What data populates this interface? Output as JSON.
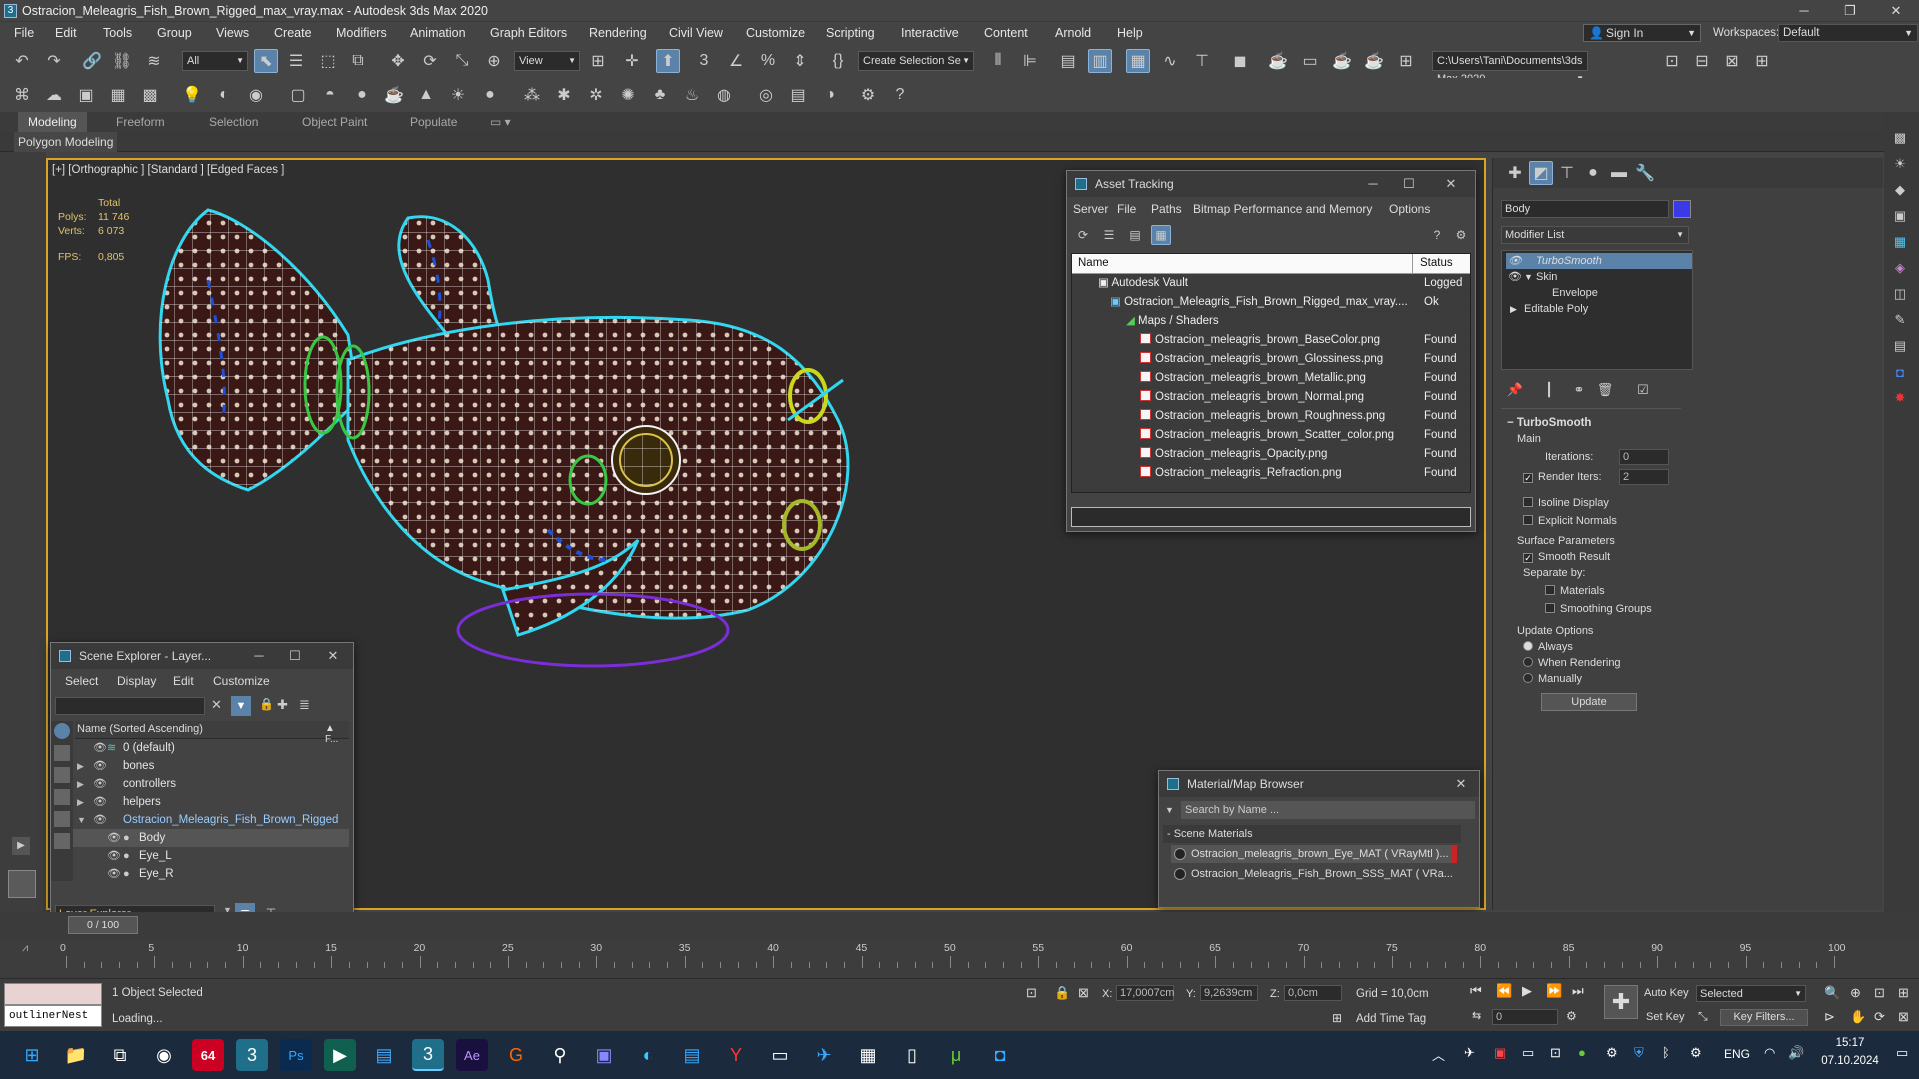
{
  "window": {
    "title": "Ostracion_Meleagris_Fish_Brown_Rigged_max_vray.max - Autodesk 3ds Max 2020",
    "app_icon": "3"
  },
  "menu": [
    "File",
    "Edit",
    "Tools",
    "Group",
    "Views",
    "Create",
    "Modifiers",
    "Animation",
    "Graph Editors",
    "Rendering",
    "Civil View",
    "Customize",
    "Scripting",
    "Interactive",
    "Content",
    "Arnold",
    "Help"
  ],
  "account": {
    "sign_in": "Sign In",
    "workspaces_label": "Workspaces:",
    "workspace": "Default"
  },
  "toolbar": {
    "selection_filter": "All",
    "ref_coord": "View",
    "named_selection": "Create Selection Se",
    "project_path": "C:\\Users\\Tani\\Documents\\3ds Max 2020"
  },
  "ribbon": {
    "tabs": [
      "Modeling",
      "Freeform",
      "Selection",
      "Object Paint",
      "Populate"
    ],
    "active_tab": "Modeling",
    "subpanel": "Polygon Modeling"
  },
  "viewport": {
    "label": "[+] [Orthographic ] [Standard ] [Edged Faces ]",
    "stats": {
      "total_label": "Total",
      "polys_label": "Polys:",
      "polys": "11 746",
      "verts_label": "Verts:",
      "verts": "6 073",
      "fps_label": "FPS:",
      "fps": "0,805"
    }
  },
  "asset_tracking": {
    "title": "Asset Tracking",
    "menu": [
      "Server",
      "File",
      "Paths",
      "Bitmap Performance and Memory",
      "Options"
    ],
    "columns": [
      "Name",
      "Status"
    ],
    "rows": [
      {
        "name": "Autodesk Vault",
        "status": "Logged"
      },
      {
        "name": "Ostracion_Meleagris_Fish_Brown_Rigged_max_vray....",
        "status": "Ok"
      },
      {
        "name": "Maps / Shaders",
        "status": ""
      },
      {
        "name": "Ostracion_meleagris_brown_BaseColor.png",
        "status": "Found"
      },
      {
        "name": "Ostracion_meleagris_brown_Glossiness.png",
        "status": "Found"
      },
      {
        "name": "Ostracion_meleagris_brown_Metallic.png",
        "status": "Found"
      },
      {
        "name": "Ostracion_meleagris_brown_Normal.png",
        "status": "Found"
      },
      {
        "name": "Ostracion_meleagris_brown_Roughness.png",
        "status": "Found"
      },
      {
        "name": "Ostracion_meleagris_brown_Scatter_color.png",
        "status": "Found"
      },
      {
        "name": "Ostracion_meleagris_Opacity.png",
        "status": "Found"
      },
      {
        "name": "Ostracion_meleagris_Refraction.png",
        "status": "Found"
      }
    ]
  },
  "scene_explorer": {
    "title": "Scene Explorer - Layer...",
    "menu": [
      "Select",
      "Display",
      "Edit",
      "Customize"
    ],
    "column": "Name (Sorted Ascending)",
    "column_right": "▲ F...",
    "rows": [
      {
        "name": "0 (default)"
      },
      {
        "name": "bones"
      },
      {
        "name": "controllers"
      },
      {
        "name": "helpers"
      },
      {
        "name": "Ostracion_Meleagris_Fish_Brown_Rigged"
      },
      {
        "name": "Body"
      },
      {
        "name": "Eye_L"
      },
      {
        "name": "Eye_R"
      }
    ],
    "footer": "Layer Explorer"
  },
  "material_browser": {
    "title": "Material/Map Browser",
    "search_placeholder": "Search by Name ...",
    "section": "- Scene Materials",
    "items": [
      "Ostracion_meleagris_brown_Eye_MAT ( VRayMtl )...",
      "Ostracion_Meleagris_Fish_Brown_SSS_MAT ( VRa..."
    ]
  },
  "command_panel": {
    "object_name": "Body",
    "modifier_list": "Modifier List",
    "stack": [
      "TurboSmooth",
      "Skin",
      "Envelope",
      "Editable Poly"
    ],
    "rollout_title": "TurboSmooth",
    "main_label": "Main",
    "iterations_label": "Iterations:",
    "iterations": "0",
    "render_iters_label": "Render Iters:",
    "render_iters": "2",
    "isoline_display": "Isoline Display",
    "explicit_normals": "Explicit Normals",
    "surface_params": "Surface Parameters",
    "smooth_result": "Smooth Result",
    "separate_by": "Separate by:",
    "materials": "Materials",
    "smoothing_groups": "Smoothing Groups",
    "update_options": "Update Options",
    "always": "Always",
    "when_rendering": "When Rendering",
    "manually": "Manually",
    "update_button": "Update"
  },
  "timeline": {
    "slider": "0 / 100",
    "ticks": [
      "0",
      "5",
      "10",
      "15",
      "20",
      "25",
      "30",
      "35",
      "40",
      "45",
      "50",
      "55",
      "60",
      "65",
      "70",
      "75",
      "80",
      "85",
      "90",
      "95",
      "100"
    ]
  },
  "status": {
    "maxscript": "outlinerNest",
    "selected": "1 Object Selected",
    "loading": "Loading...",
    "x_label": "X:",
    "x": "17,0007cm",
    "y_label": "Y:",
    "y": "9,2639cm",
    "z_label": "Z:",
    "z": "0,0cm",
    "grid": "Grid = 10,0cm",
    "add_time_tag": "Add Time Tag",
    "auto_key": "Auto Key",
    "set_key": "Set Key",
    "selected_mode": "Selected",
    "key_filters": "Key Filters...",
    "frame": "0"
  },
  "taskbar": {
    "lang": "ENG",
    "time": "15:17",
    "date": "07.10.2024",
    "badge": "64"
  }
}
